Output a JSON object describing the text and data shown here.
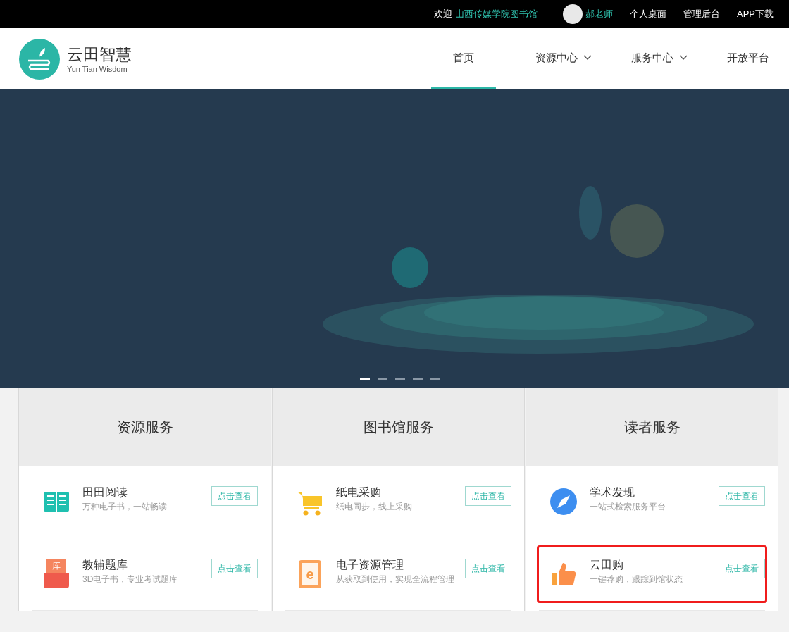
{
  "top_bar": {
    "welcome": "欢迎",
    "library": "山西传媒学院图书馆",
    "user": "郝老师",
    "links": [
      "个人桌面",
      "管理后台",
      "APP下载"
    ]
  },
  "header": {
    "logo_title": "云田智慧",
    "logo_subtitle": "Yun Tian Wisdom",
    "nav": [
      {
        "label": "首页",
        "selected": true,
        "dropdown": false
      },
      {
        "label": "资源中心",
        "selected": false,
        "dropdown": true
      },
      {
        "label": "服务中心",
        "selected": false,
        "dropdown": true
      },
      {
        "label": "开放平台",
        "selected": false,
        "dropdown": false
      }
    ]
  },
  "carousel": {
    "dots": [
      {
        "selected": true
      },
      {
        "selected": false
      },
      {
        "selected": false
      },
      {
        "selected": false
      },
      {
        "selected": false
      }
    ]
  },
  "columns": [
    {
      "title": "资源服务",
      "items": [
        {
          "kind": "book",
          "name": "田田阅读",
          "desc": "万种电子书，一站畅读",
          "button": "点击查看",
          "highlighted": false
        },
        {
          "kind": "quiz",
          "name": "教辅题库",
          "desc": "3D电子书，专业考试题库",
          "button": "点击查看",
          "highlighted": false,
          "icon_text": "库"
        }
      ]
    },
    {
      "title": "图书馆服务",
      "items": [
        {
          "kind": "cart",
          "name": "纸电采购",
          "desc": "纸电同步，线上采购",
          "button": "点击查看",
          "highlighted": false
        },
        {
          "kind": "ebook",
          "name": "电子资源管理",
          "desc": "从获取到使用，实现全流程管理",
          "button": "点击查看",
          "highlighted": false,
          "icon_text": "e"
        }
      ]
    },
    {
      "title": "读者服务",
      "items": [
        {
          "kind": "compass",
          "name": "学术发现",
          "desc": "一站式检索服务平台",
          "button": "点击查看",
          "highlighted": false
        },
        {
          "kind": "thumb",
          "name": "云田购",
          "desc": "一键荐购，跟踪到馆状态",
          "button": "点击查看",
          "highlighted": true
        }
      ]
    }
  ]
}
